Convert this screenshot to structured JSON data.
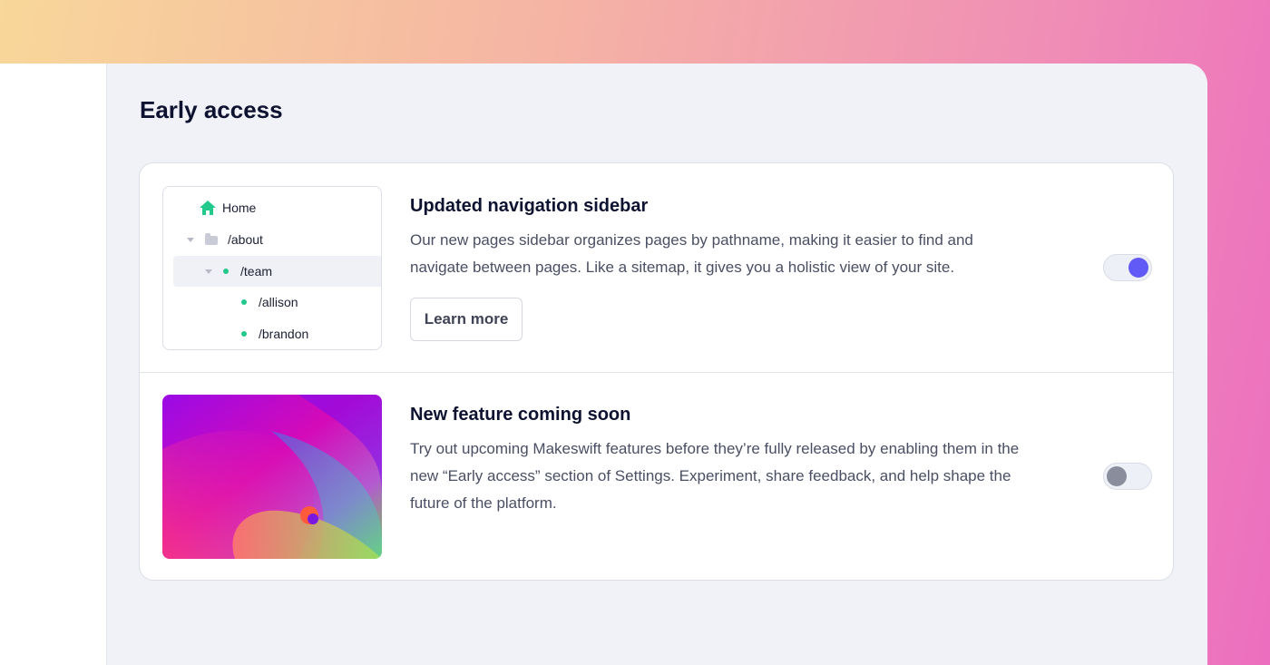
{
  "page": {
    "title": "Early access"
  },
  "features": [
    {
      "title": "Updated navigation sidebar",
      "description": "Our new pages sidebar organizes pages by pathname, making it easier to find and navigate between pages. Like a sitemap, it gives you a holistic view of your site.",
      "button_label": "Learn more",
      "enabled": true,
      "preview": {
        "tree": [
          {
            "label": "Home",
            "icon": "home-icon"
          },
          {
            "label": "/about",
            "icon": "folder-icon",
            "expanded": true
          },
          {
            "label": "/team",
            "icon": "page-dot-icon",
            "expanded": true,
            "active": true
          },
          {
            "label": "/allison",
            "icon": "page-dot-icon"
          },
          {
            "label": "/brandon",
            "icon": "page-dot-icon"
          }
        ]
      }
    },
    {
      "title": "New feature coming soon",
      "description": "Try out upcoming Makeswift features before they’re fully released by enabling them in the new “Early access” section of Settings. Experiment, share feedback, and help shape the future of the platform.",
      "enabled": false
    }
  ],
  "colors": {
    "accent": "#625af6",
    "tree_dot": "#22c98b",
    "home_icon": "#22c98b",
    "toggle_off_knob": "#8a8d9c"
  }
}
